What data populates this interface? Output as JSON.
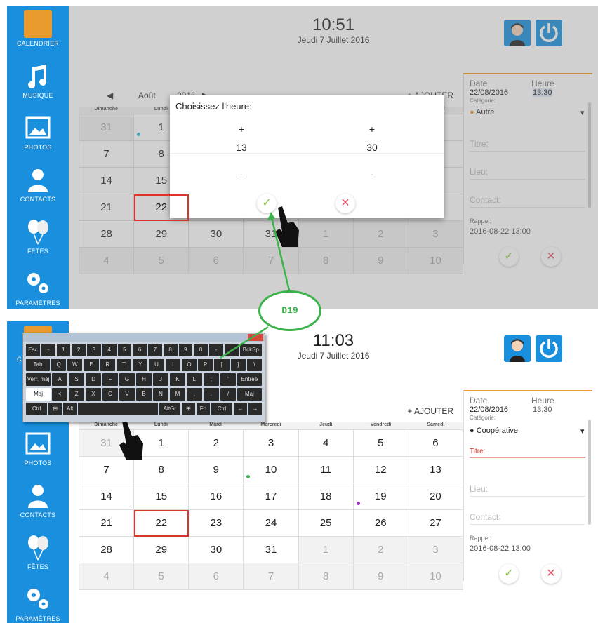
{
  "annotation": {
    "label": "D19",
    "color": "#3bb34a"
  },
  "sidebar": {
    "color": "#1a8fdd",
    "items": [
      {
        "label": "CALENDRIER",
        "icon": "calendar-icon"
      },
      {
        "label": "MUSIQUE",
        "icon": "music-icon"
      },
      {
        "label": "PHOTOS",
        "icon": "photos-icon"
      },
      {
        "label": "CONTACTS",
        "icon": "contacts-icon"
      },
      {
        "label": "FÊTES",
        "icon": "balloons-icon"
      },
      {
        "label": "PARAMÈTRES",
        "icon": "gears-icon"
      }
    ]
  },
  "day_names": [
    "Dimanche",
    "Lundi",
    "Mardi",
    "Mercredi",
    "Jeudi",
    "Vendredi",
    "Samedi"
  ],
  "weeks": [
    [
      "31",
      "1",
      "2",
      "3",
      "4",
      "5",
      "6"
    ],
    [
      "7",
      "8",
      "9",
      "10",
      "11",
      "12",
      "13"
    ],
    [
      "14",
      "15",
      "16",
      "17",
      "18",
      "19",
      "20"
    ],
    [
      "21",
      "22",
      "23",
      "24",
      "25",
      "26",
      "27"
    ],
    [
      "28",
      "29",
      "30",
      "31",
      "1",
      "2",
      "3"
    ],
    [
      "4",
      "5",
      "6",
      "7",
      "8",
      "9",
      "10"
    ]
  ],
  "screen1": {
    "time": "10:51",
    "date": "Jeudi 7 Juillet 2016",
    "month": "Août",
    "year": "2016",
    "prev": "◀",
    "next": "▶",
    "add": "+ AJOUTER",
    "modal": {
      "title": "Choisissez l'heure:",
      "plus": "+",
      "minus": "-",
      "hour": "13",
      "minute": "30",
      "ok": "✓",
      "cancel": "✕"
    },
    "side": {
      "date_label": "Date",
      "hour_label": "Heure",
      "date_value": "22/08/2016",
      "hour_value": "13:30",
      "category_label": "Catégorie:",
      "category_value": "Autre",
      "title_field": "Titre:",
      "place_field": "Lieu:",
      "contact_field": "Contact:",
      "reminder_label": "Rappel:",
      "reminder_value": "2016-08-22 13:00"
    }
  },
  "screen2": {
    "time": "11:03",
    "date": "Jeudi 7 Juillet 2016",
    "add": "+ AJOUTER",
    "side": {
      "date_label": "Date",
      "hour_label": "Heure",
      "date_value": "22/08/2016",
      "hour_value": "13:30",
      "category_label": "Catégorie:",
      "category_value": "Coopérative",
      "title_field": "Titre:",
      "place_field": "Lieu:",
      "contact_field": "Contact:",
      "reminder_label": "Rappel:",
      "reminder_value": "2016-08-22 13:00"
    },
    "keyboard": {
      "rows": [
        [
          "Esc",
          "~",
          "1",
          "2",
          "3",
          "4",
          "5",
          "6",
          "7",
          "8",
          "9",
          "0",
          "-",
          "=",
          "BckSp"
        ],
        [
          "Tab",
          "Q",
          "W",
          "E",
          "R",
          "T",
          "Y",
          "U",
          "I",
          "O",
          "P",
          "[",
          "]",
          "\\"
        ],
        [
          "Verr. maj",
          "A",
          "S",
          "D",
          "F",
          "G",
          "H",
          "J",
          "K",
          "L",
          ";",
          "'",
          "Entrée"
        ],
        [
          "Maj",
          "<",
          "Z",
          "X",
          "C",
          "V",
          "B",
          "N",
          "M",
          ",",
          ".",
          "/",
          "Maj"
        ],
        [
          "Ctrl",
          "⊞",
          "Alt",
          " ",
          "AltGr",
          "⊞",
          "Fn",
          "Ctrl",
          "←",
          "→"
        ]
      ]
    }
  }
}
